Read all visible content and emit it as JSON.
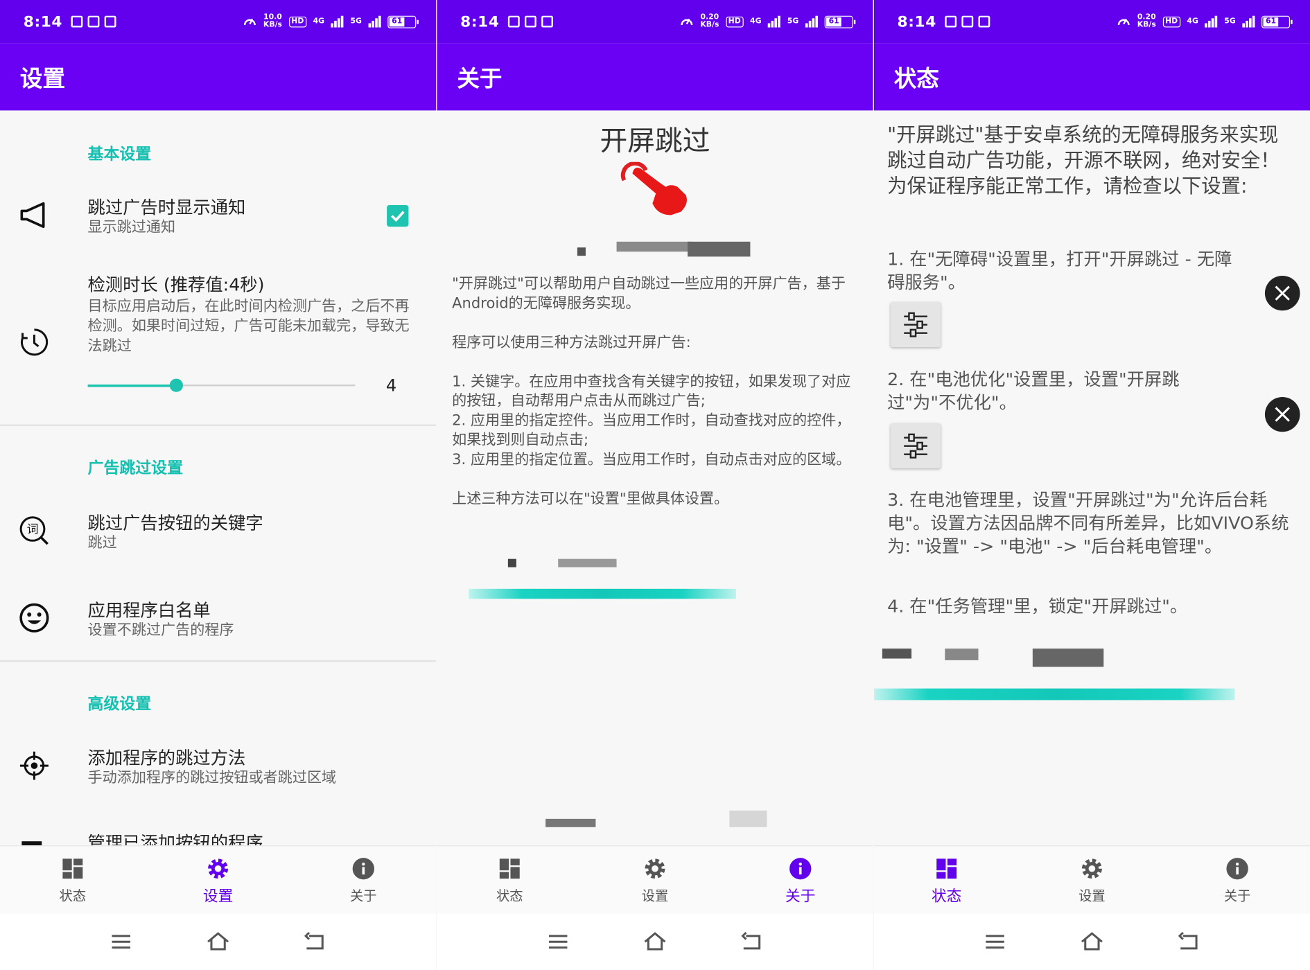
{
  "status_bar": {
    "time": "8:14",
    "speed_left": [
      "10.0",
      "KB/s"
    ],
    "speed": [
      "0.20",
      "KB/s"
    ],
    "hd": "HD",
    "net1": "4G",
    "net2": "5G",
    "battery": "61"
  },
  "nav": {
    "status": "状态",
    "settings": "设置",
    "about": "关于"
  },
  "settings": {
    "title": "设置",
    "basic_header": "基本设置",
    "notify_title": "跳过广告时显示通知",
    "notify_sub": "显示跳过通知",
    "notify_checked": true,
    "detect_title": "检测时长 (推荐值:4秒)",
    "detect_sub": "目标应用启动后，在此时间内检测广告，之后不再检测。如果时间过短，广告可能未加载完，导致无法跳过",
    "detect_value": "4",
    "detect_fraction": 0.33,
    "ad_header": "广告跳过设置",
    "keyword_title": "跳过广告按钮的关键字",
    "keyword_sub": "跳过",
    "whitelist_title": "应用程序白名单",
    "whitelist_sub": "设置不跳过广告的程序",
    "adv_header": "高级设置",
    "add_title": "添加程序的跳过方法",
    "add_sub": "手动添加程序的跳过按钮或者跳过区域",
    "manage_title": "管理已添加按钮的程序"
  },
  "about": {
    "title": "关于",
    "app_name": "开屏跳过",
    "p1": "\"开屏跳过\"可以帮助用户自动跳过一些应用的开屏广告，基于Android的无障碍服务实现。",
    "p2": "程序可以使用三种方法跳过开屏广告:",
    "m1": "1. 关键字。在应用中查找含有关键字的按钮，如果发现了对应的按钮，自动帮用户点击从而跳过广告;",
    "m2": "2. 应用里的指定控件。当应用工作时，自动查找对应的控件，如果找到则自动点击;",
    "m3": "3. 应用里的指定位置。当应用工作时，自动点击对应的区域。",
    "p4": "上述三种方法可以在\"设置\"里做具体设置。"
  },
  "status": {
    "title": "状态",
    "intro": "\"开屏跳过\"基于安卓系统的无障碍服务来实现跳过自动广告功能，开源不联网，绝对安全！为保证程序能正常工作，请检查以下设置:",
    "s1": "1. 在\"无障碍\"设置里，打开\"开屏跳过 - 无障碍服务\"。",
    "s2": "2. 在\"电池优化\"设置里，设置\"开屏跳过\"为\"不优化\"。",
    "s3": "3. 在电池管理里，设置\"开屏跳过\"为\"允许后台耗电\"。设置方法因品牌不同有所差异，比如VIVO系统为: \"设置\" -> \"电池\" -> \"后台耗电管理\"。",
    "s4": "4. 在\"任务管理\"里，锁定\"开屏跳过\"。"
  },
  "colors": {
    "primary": "#6200ee",
    "appbar": "#6a00f4",
    "accent": "#1ec4b0",
    "close": "#222222"
  }
}
